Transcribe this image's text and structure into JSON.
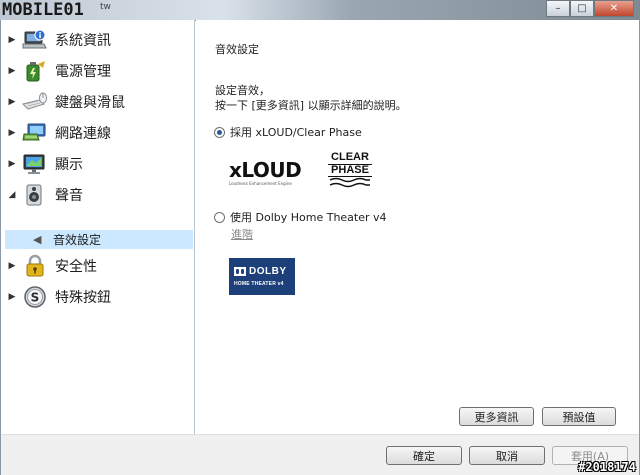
{
  "window": {
    "logo_text": "MOBILE01",
    "logo_sub": "tw",
    "minimize_label": "–",
    "maximize_label": "□",
    "close_label": "✕"
  },
  "sidebar": {
    "items": [
      {
        "label": "系統資訊",
        "icon": "laptop-info-icon",
        "expanded": false
      },
      {
        "label": "電源管理",
        "icon": "battery-icon",
        "expanded": false
      },
      {
        "label": "鍵盤與滑鼠",
        "icon": "keyboard-mouse-icon",
        "expanded": false
      },
      {
        "label": "網路連線",
        "icon": "network-icon",
        "expanded": false
      },
      {
        "label": "顯示",
        "icon": "display-icon",
        "expanded": false
      },
      {
        "label": "聲音",
        "icon": "speaker-icon",
        "expanded": true
      },
      {
        "label": "安全性",
        "icon": "lock-icon",
        "expanded": false
      },
      {
        "label": "特殊按鈕",
        "icon": "special-button-icon",
        "expanded": false
      }
    ],
    "sub_item": {
      "label": "音效設定",
      "icon": "speaker-small-icon"
    }
  },
  "content": {
    "section_title": "音效設定",
    "desc_line1": "設定音效，",
    "desc_line2": "按一下 [更多資訊] 以顯示詳細的說明。",
    "option1_label": "採用 xLOUD/Clear Phase",
    "option1_checked": true,
    "option2_label": "使用 Dolby Home Theater v4",
    "option2_checked": false,
    "advanced_link": "進階",
    "xloud_logo": "xLOUD",
    "xloud_sub": "Loudness Enhancement Engine",
    "clear_phase_line1": "CLEAR",
    "clear_phase_line2": "PHASE",
    "dolby_main": "DOLBY",
    "dolby_sub": "HOME THEATER v4",
    "more_info_button": "更多資訊",
    "default_button": "預設值"
  },
  "footer": {
    "ok_button": "確定",
    "cancel_button": "取消",
    "apply_button": "套用(A)"
  },
  "watermark": "#2018174",
  "colors": {
    "selection": "#cce8ff",
    "dolby_blue": "#1d3f7a",
    "radio_dot": "#2a5a9a"
  }
}
